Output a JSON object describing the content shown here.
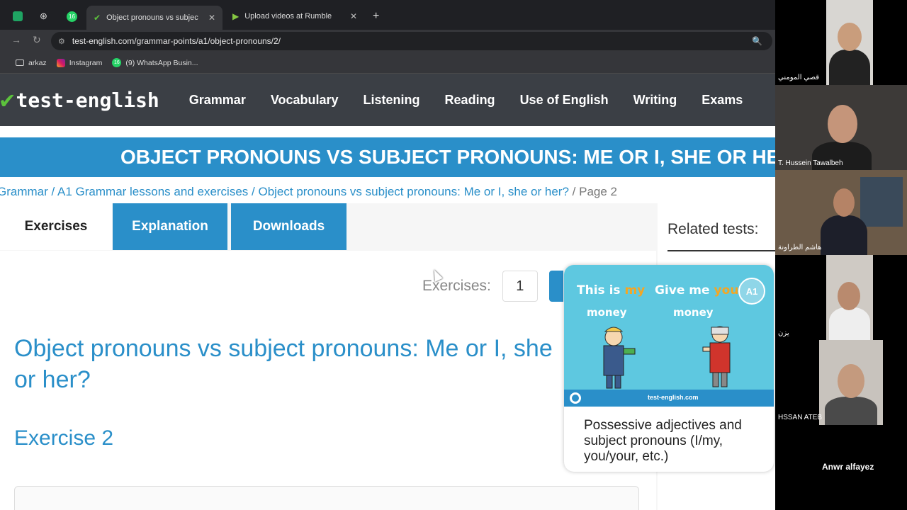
{
  "browser": {
    "tabs": [
      {
        "label": "",
        "icon": "sheets-icon"
      },
      {
        "label": "",
        "icon": "chatgpt-icon"
      },
      {
        "label": "16",
        "icon": "whatsapp-icon"
      },
      {
        "label": "Object pronouns vs subject pro",
        "icon": "check-icon",
        "active": true
      },
      {
        "label": "Upload videos at Rumble",
        "icon": "rumble-icon"
      }
    ],
    "new_tab": "+",
    "close": "✕",
    "url": "test-english.com/grammar-points/a1/object-pronouns/2/",
    "bookmarks": [
      {
        "label": "arkaz",
        "icon": "folder-icon"
      },
      {
        "label": "Instagram",
        "icon": "instagram-icon"
      },
      {
        "label": "(9) WhatsApp Busin...",
        "icon": "whatsapp-icon",
        "badge": "16"
      }
    ]
  },
  "site": {
    "logo": "test-english",
    "nav": [
      "Grammar",
      "Vocabulary",
      "Listening",
      "Reading",
      "Use of English",
      "Writing",
      "Exams"
    ],
    "banner": "OBJECT PRONOUNS VS SUBJECT PRONOUNS: ME OR I, SHE OR HER?",
    "breadcrumb": {
      "links": [
        "Grammar",
        "A1 Grammar lessons and exercises",
        "Object pronouns vs subject pronouns: Me or I, she or her?"
      ],
      "current": "Page 2",
      "sep": " / "
    },
    "tabs": {
      "exercises": "Exercises",
      "explanation": "Explanation",
      "downloads": "Downloads"
    },
    "exercises_label": "Exercises:",
    "exercise_number": "1",
    "title": "Object pronouns vs subject pronouns: Me or I, she or her?",
    "exercise_heading": "Exercise 2",
    "related_title": "Related tests:",
    "related_card": {
      "image_text_1": "This is",
      "image_text_1b": "my",
      "image_text_1c": "money",
      "image_text_2": "Give me",
      "image_text_2b": "your",
      "image_text_2c": "money",
      "badge": "A1",
      "footer": "test-english.com",
      "text": "Possessive adjectives and subject pronouns (I/my, you/your, etc.)"
    }
  },
  "video_call": {
    "participants": [
      "قصي المومني",
      "T. Hussein Tawalbeh",
      "هاشم الطراونة",
      "يزن",
      "HSSAN ATEB",
      "Anwr alfayez"
    ]
  },
  "colors": {
    "brand_blue": "#2a8fc9",
    "nav_dark": "#3b3f45",
    "logo_green": "#5cc23c"
  }
}
